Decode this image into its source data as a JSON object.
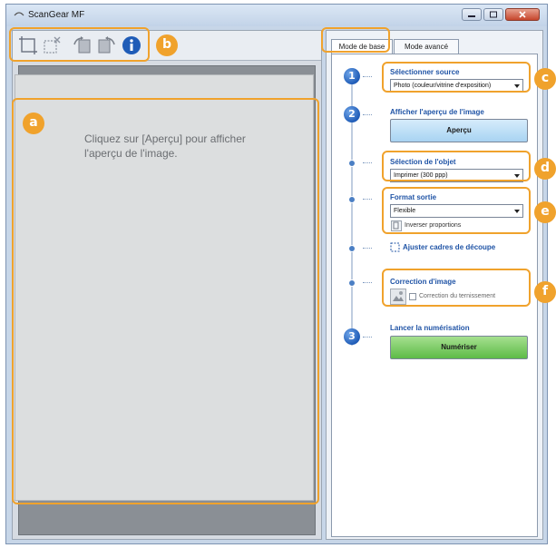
{
  "window": {
    "title": "ScanGear MF"
  },
  "callouts": {
    "a": "a",
    "b": "b",
    "c": "c",
    "d": "d",
    "e": "e",
    "f": "f"
  },
  "preview": {
    "message": "Cliquez sur [Aperçu] pour afficher l'aperçu de l'image."
  },
  "tabs": {
    "basic": "Mode de base",
    "advanced": "Mode avancé"
  },
  "steps": {
    "one": "1",
    "two": "2",
    "three": "3",
    "select_source": {
      "heading": "Sélectionner source",
      "value": "Photo (couleur/vitrine d'exposition)"
    },
    "preview_image": {
      "heading": "Afficher l'aperçu de l'image",
      "button": "Aperçu"
    },
    "object_select": {
      "heading": "Sélection de l'objet",
      "value": "Imprimer (300 ppp)"
    },
    "output_format": {
      "heading": "Format sortie",
      "value": "Flexible",
      "invert": "Inverser proportions"
    },
    "adjust_crop": "Ajuster cadres de découpe",
    "image_correction": {
      "heading": "Correction d'image",
      "fading": "Correction du ternissement"
    },
    "start_scan": {
      "heading": "Lancer la numérisation",
      "button": "Numériser"
    }
  },
  "colors": {
    "callout": "#f0a22c",
    "accent": "#2054a6"
  },
  "icons": [
    "crop-icon",
    "remove-crop-icon",
    "rotate-left-icon",
    "rotate-right-icon",
    "info-icon"
  ]
}
